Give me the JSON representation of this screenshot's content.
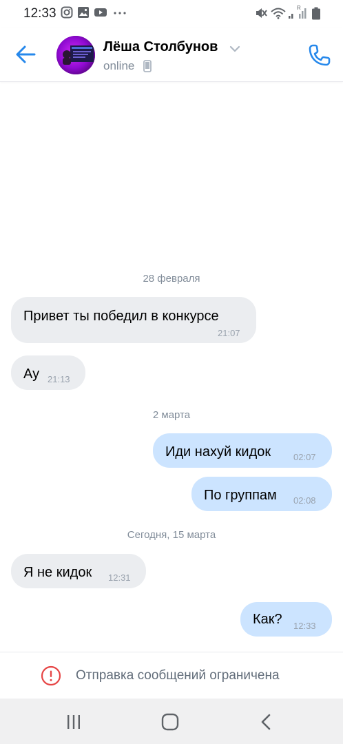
{
  "status_bar": {
    "time": "12:33",
    "left_icons": [
      "instagram-icon",
      "gallery-icon",
      "youtube-icon",
      "more-dots-icon"
    ],
    "right_icons": [
      "mute-icon",
      "wifi-icon",
      "signal-icon",
      "battery-icon"
    ],
    "signal_label": "R"
  },
  "header": {
    "contact_name": "Лёша Столбунов",
    "status": "online",
    "accent_color": "#2688eb"
  },
  "messages": [
    {
      "type": "date",
      "text": "28 февраля"
    },
    {
      "type": "in",
      "text": "Привет ты победил в конкурсе",
      "time": "21:07"
    },
    {
      "type": "in",
      "text": "Ау",
      "time": "21:13"
    },
    {
      "type": "date",
      "text": "2 марта"
    },
    {
      "type": "out",
      "text": "Иди нахуй кидок",
      "time": "02:07"
    },
    {
      "type": "out",
      "text": "По группам",
      "time": "02:08"
    },
    {
      "type": "date",
      "text": "Сегодня, 15 марта"
    },
    {
      "type": "in",
      "text": "Я не кидок",
      "time": "12:31"
    },
    {
      "type": "out",
      "text": "Как?",
      "time": "12:33"
    }
  ],
  "footer": {
    "restriction_text": "Отправка сообщений ограничена",
    "icon": "warning-circle-icon",
    "icon_color": "#e64646"
  },
  "nav_bar": {
    "buttons": [
      "recent-apps-icon",
      "home-icon",
      "back-nav-icon"
    ]
  }
}
